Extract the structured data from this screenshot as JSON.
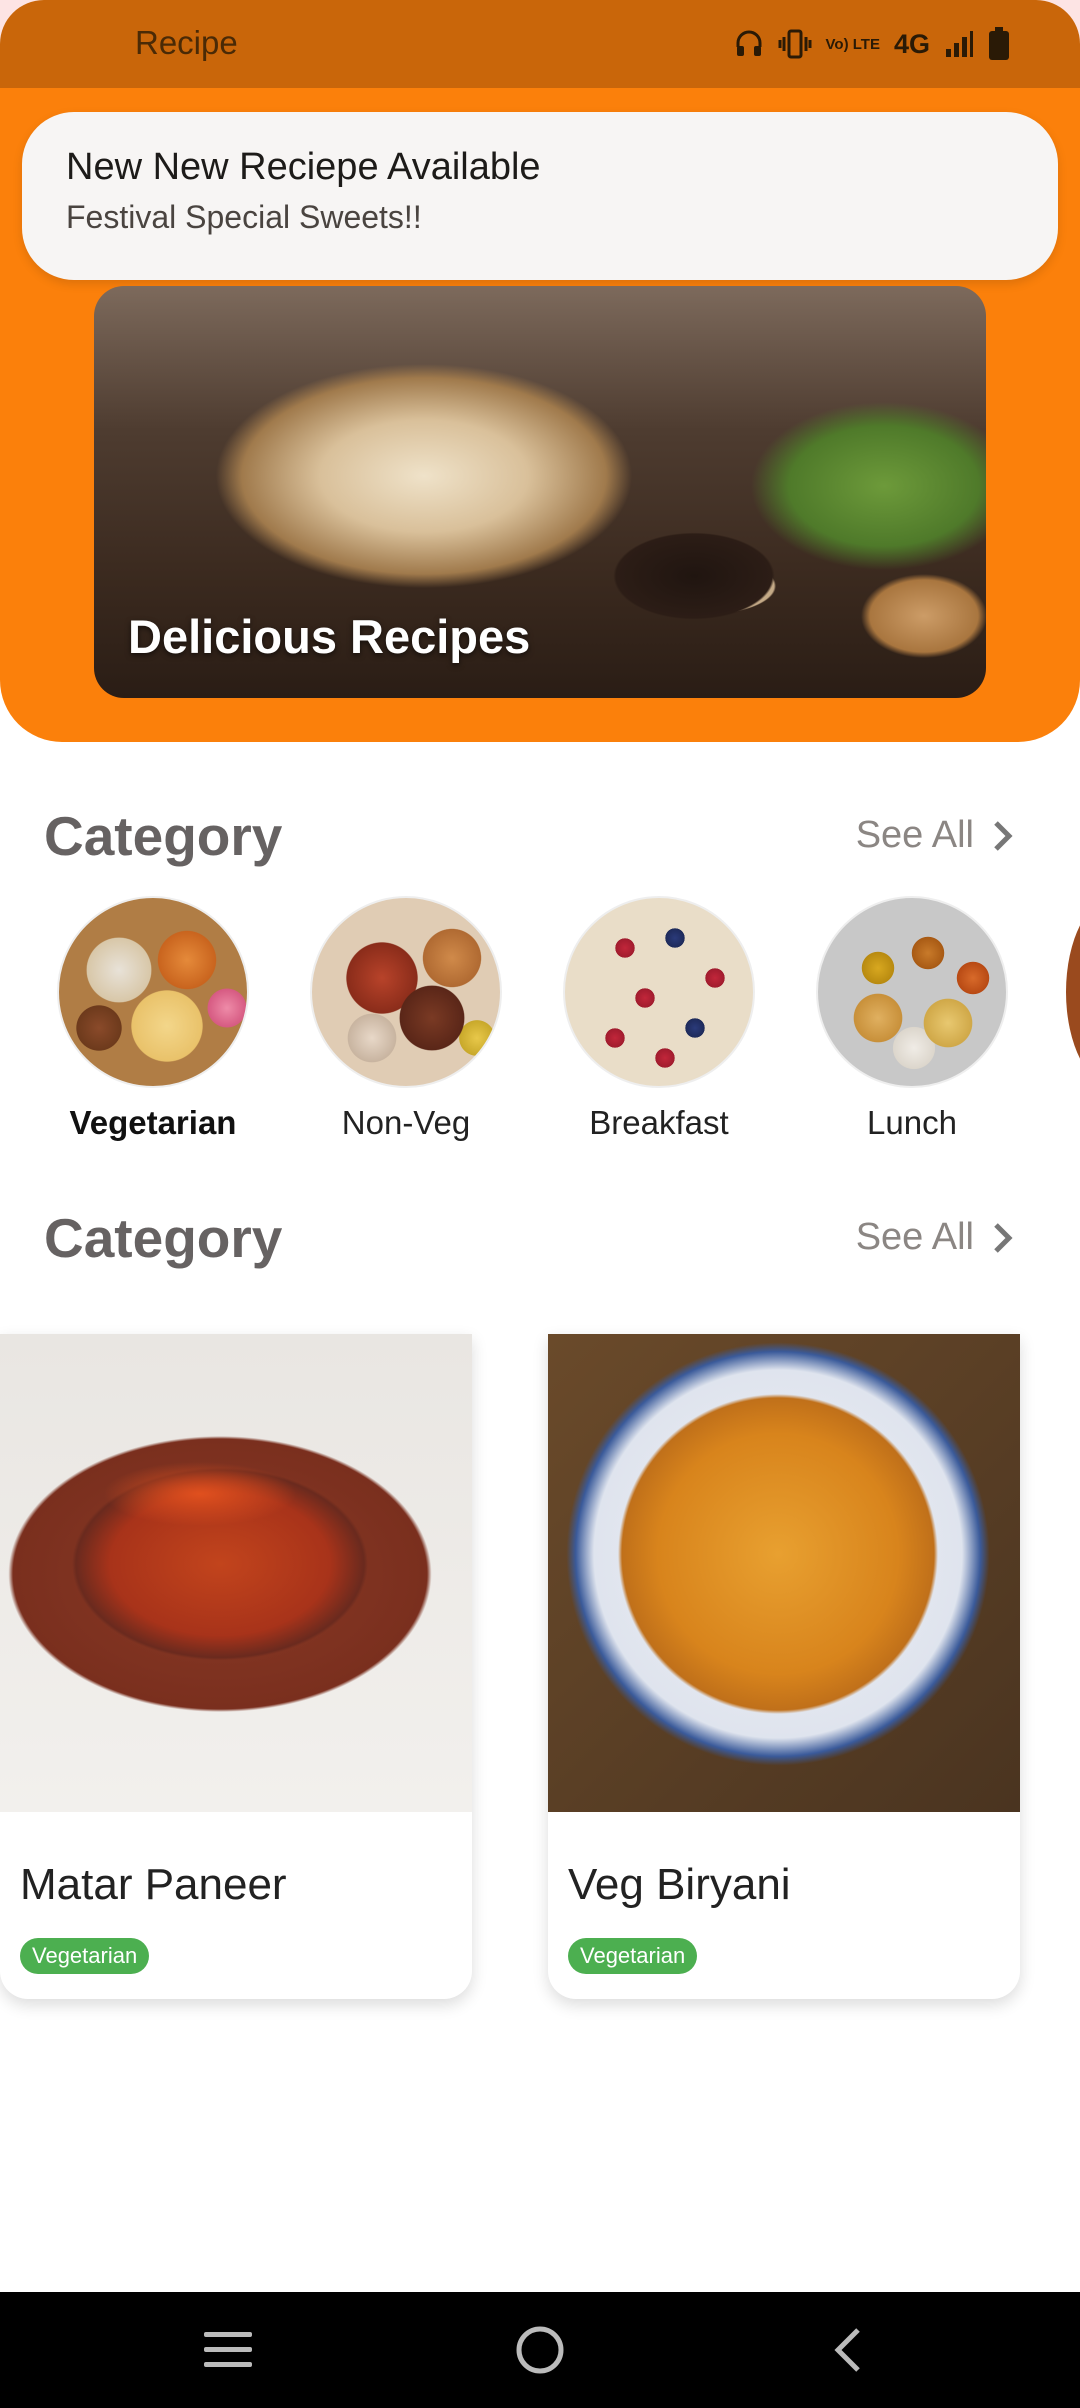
{
  "status_bar": {
    "app_title": "Recipe",
    "icons": [
      "headphones-icon",
      "vibrate-icon",
      "volte-icon",
      "4g-icon",
      "signal-icon",
      "battery-icon"
    ],
    "volte_label": "Vo) LTE",
    "network_label": "4G"
  },
  "notification": {
    "title": "New New Reciepe Available",
    "body": "Festival Special Sweets!!"
  },
  "hero": {
    "title": "Delicious Recipes"
  },
  "category_section": {
    "title": "Category",
    "see_all": "See All",
    "items": [
      {
        "label": "Vegetarian",
        "selected": true
      },
      {
        "label": "Non-Veg",
        "selected": false
      },
      {
        "label": "Breakfast",
        "selected": false
      },
      {
        "label": "Lunch",
        "selected": false
      }
    ]
  },
  "recipe_section": {
    "title": "Category",
    "see_all": "See All",
    "recipes": [
      {
        "name": "Matar Paneer",
        "tag": "Vegetarian"
      },
      {
        "name": "Veg Biryani",
        "tag": "Vegetarian"
      }
    ]
  },
  "colors": {
    "header_orange": "#fb800b",
    "status_bar": "#c9660a",
    "tag_green": "#4caf50"
  },
  "nav": {
    "icons": [
      "menu-icon",
      "home-icon",
      "back-icon"
    ]
  }
}
